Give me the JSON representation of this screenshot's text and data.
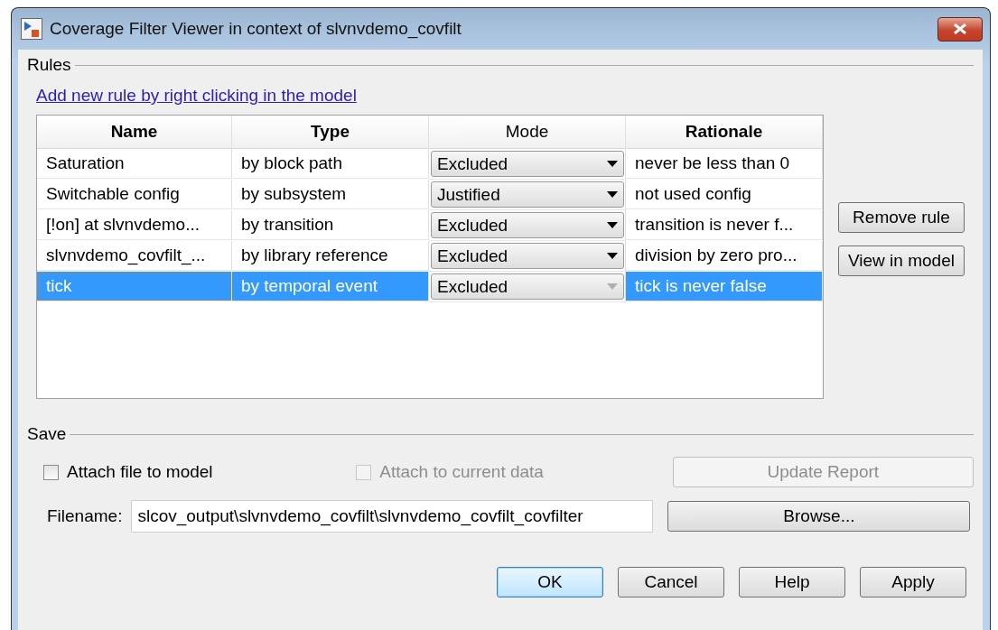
{
  "window": {
    "title": "Coverage Filter Viewer in context of slvnvdemo_covfilt"
  },
  "rules": {
    "title": "Rules",
    "add_link": "Add new rule by right clicking in the model",
    "table": {
      "columns": [
        {
          "label": "Name",
          "emphasized": true
        },
        {
          "label": "Type",
          "emphasized": true
        },
        {
          "label": "Mode",
          "emphasized": false
        },
        {
          "label": "Rationale",
          "emphasized": true
        }
      ],
      "rows": [
        {
          "name": "Saturation",
          "type": "by block path",
          "mode": "Excluded",
          "rationale": "never be less than 0",
          "selected": false
        },
        {
          "name": "Switchable config",
          "type": "by subsystem",
          "mode": "Justified",
          "rationale": "not used config",
          "selected": false
        },
        {
          "name": "[!on] at slvnvdemo...",
          "type": "by transition",
          "mode": "Excluded",
          "rationale": "transition is never f...",
          "selected": false
        },
        {
          "name": "slvnvdemo_covfilt_...",
          "type": "by library reference",
          "mode": "Excluded",
          "rationale": "division by zero pro...",
          "selected": false
        },
        {
          "name": "tick",
          "type": "by temporal event",
          "mode": "Excluded",
          "rationale": "tick is never false",
          "selected": true
        }
      ]
    },
    "buttons": [
      "Remove rule",
      "View in model"
    ]
  },
  "save": {
    "title": "Save",
    "checkboxes": [
      {
        "label": "Attach file to model",
        "checked": false,
        "disabled": false
      },
      {
        "label": "Attach to current data",
        "checked": false,
        "disabled": true
      }
    ],
    "update_button": {
      "label": "Update Report",
      "disabled": true
    },
    "filename": {
      "label": "Filename:",
      "value": "slcov_output\\slvnvdemo_covfilt\\slvnvdemo_covfilt_covfilter"
    },
    "browse_button": "Browse..."
  },
  "footer_buttons": [
    {
      "label": "OK",
      "default": true
    },
    {
      "label": "Cancel",
      "default": false
    },
    {
      "label": "Help",
      "default": false
    },
    {
      "label": "Apply",
      "default": false
    }
  ]
}
